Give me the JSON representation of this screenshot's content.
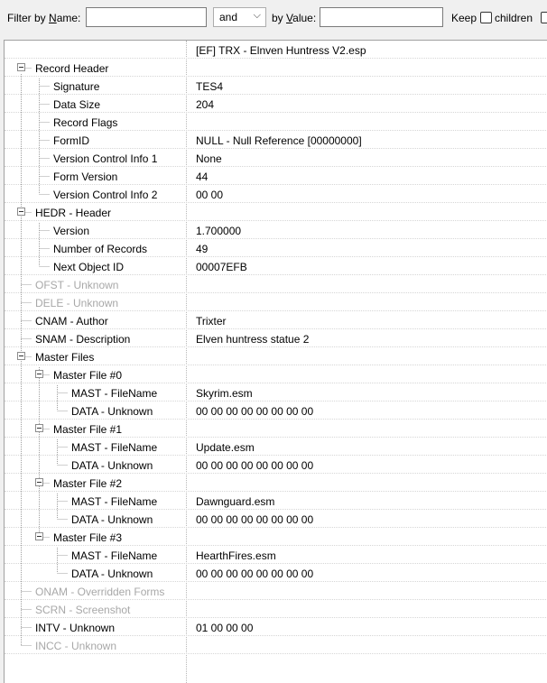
{
  "filter": {
    "name_label_pre": "Filter by ",
    "name_label_u": "N",
    "name_label_post": "ame:",
    "name_value": "",
    "operator": "and",
    "value_label_pre": "by ",
    "value_label_u": "V",
    "value_label_post": "alue:",
    "value_value": "",
    "keep_label": "Keep",
    "children_label": "children"
  },
  "tree": {
    "rows": [
      {
        "name": "",
        "value": "[EF] TRX - Elnven Huntress V2.esp"
      },
      {
        "name": "Record Header",
        "value": ""
      },
      {
        "name": "Signature",
        "value": "TES4"
      },
      {
        "name": "Data Size",
        "value": "204"
      },
      {
        "name": "Record Flags",
        "value": ""
      },
      {
        "name": "FormID",
        "value": "NULL - Null Reference [00000000]"
      },
      {
        "name": "Version Control Info 1",
        "value": "None"
      },
      {
        "name": "Form Version",
        "value": "44"
      },
      {
        "name": "Version Control Info 2",
        "value": "00 00"
      },
      {
        "name": "HEDR - Header",
        "value": ""
      },
      {
        "name": "Version",
        "value": "1.700000"
      },
      {
        "name": "Number of Records",
        "value": "49"
      },
      {
        "name": "Next Object ID",
        "value": "00007EFB"
      },
      {
        "name": "OFST - Unknown",
        "value": ""
      },
      {
        "name": "DELE - Unknown",
        "value": ""
      },
      {
        "name": "CNAM - Author",
        "value": "Trixter"
      },
      {
        "name": "SNAM - Description",
        "value": "Elven huntress statue 2"
      },
      {
        "name": "Master Files",
        "value": ""
      },
      {
        "name": "Master File #0",
        "value": ""
      },
      {
        "name": "MAST - FileName",
        "value": "Skyrim.esm"
      },
      {
        "name": "DATA - Unknown",
        "value": "00 00 00 00 00 00 00 00"
      },
      {
        "name": "Master File #1",
        "value": ""
      },
      {
        "name": "MAST - FileName",
        "value": "Update.esm"
      },
      {
        "name": "DATA - Unknown",
        "value": "00 00 00 00 00 00 00 00"
      },
      {
        "name": "Master File #2",
        "value": ""
      },
      {
        "name": "MAST - FileName",
        "value": "Dawnguard.esm"
      },
      {
        "name": "DATA - Unknown",
        "value": "00 00 00 00 00 00 00 00"
      },
      {
        "name": "Master File #3",
        "value": ""
      },
      {
        "name": "MAST - FileName",
        "value": "HearthFires.esm"
      },
      {
        "name": "DATA - Unknown",
        "value": "00 00 00 00 00 00 00 00"
      },
      {
        "name": "ONAM - Overridden Forms",
        "value": ""
      },
      {
        "name": "SCRN - Screenshot",
        "value": ""
      },
      {
        "name": "INTV - Unknown",
        "value": "01 00 00 00"
      },
      {
        "name": "INCC - Unknown",
        "value": ""
      }
    ]
  }
}
